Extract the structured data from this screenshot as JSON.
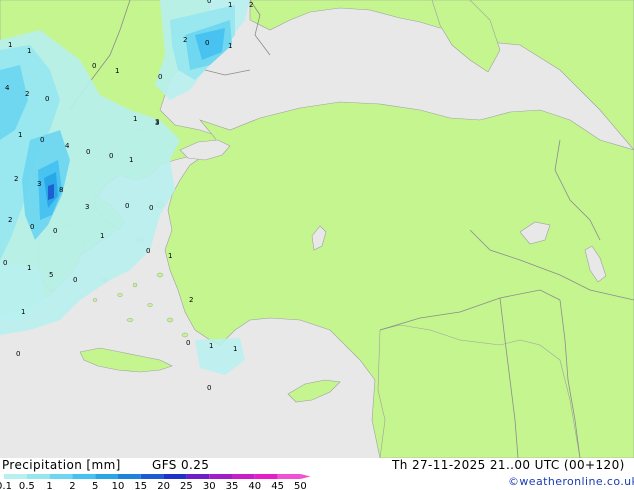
{
  "footer": {
    "title": "Precipitation [mm]",
    "model": "GFS 0.25",
    "valid_time": "Th 27-11-2025 21..00 UTC (00+120)",
    "credit": "©weatheronline.co.uk"
  },
  "legend": {
    "levels": [
      "0.1",
      "0.5",
      "1",
      "2",
      "5",
      "10",
      "15",
      "20",
      "25",
      "30",
      "35",
      "40",
      "45",
      "50"
    ],
    "colors": [
      "#b8f0f0",
      "#96e6f0",
      "#6ed6f0",
      "#46c2f0",
      "#28a6e6",
      "#1e82dc",
      "#1e5ad2",
      "#1e32c8",
      "#6e1ec8",
      "#a01ec8",
      "#c81ec8",
      "#e61ec8",
      "#f050d2"
    ]
  },
  "map_values": [
    "0",
    "1",
    "2",
    "1",
    "1",
    "1",
    "4",
    "2",
    "0",
    "0",
    "2",
    "0",
    "1",
    "0",
    "4",
    "0",
    "0",
    "1",
    "3",
    "1",
    "1",
    "0",
    "2",
    "3",
    "8",
    "0",
    "0",
    "1",
    "2",
    "0",
    "3",
    "0",
    "0",
    "0",
    "1",
    "3",
    "2",
    "5",
    "0",
    "1",
    "1",
    "0",
    "1",
    "1",
    "0",
    "0"
  ],
  "colors": {
    "land": "#c4f58e",
    "sea": "#e8e8e8",
    "border": "#8c8c8c",
    "coast": "#a0a0a0"
  }
}
